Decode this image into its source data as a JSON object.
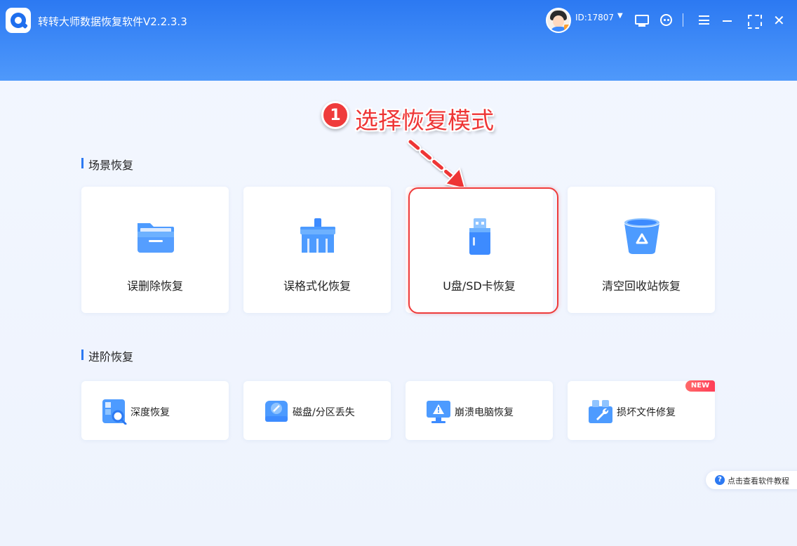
{
  "app": {
    "title": "转转大师数据恢复软件V2.2.3.3",
    "user_id": "ID:17807",
    "accent_color": "#2c79f2",
    "icons": [
      "app-logo-icon",
      "avatar",
      "chevron-down-icon",
      "monitor-icon",
      "support-icon",
      "menu-icon",
      "minimize-icon",
      "maximize-icon",
      "close-icon"
    ]
  },
  "annotation": {
    "step_number": "1",
    "text": "选择恢复模式",
    "color": "#ee3535"
  },
  "scene_recovery": {
    "title": "场景恢复",
    "items": [
      {
        "label": "误删除恢复",
        "icon": "folder-icon"
      },
      {
        "label": "误格式化恢复",
        "icon": "broom-icon"
      },
      {
        "label": "U盘/SD卡恢复",
        "icon": "usb-drive-icon",
        "highlighted": true
      },
      {
        "label": "清空回收站恢复",
        "icon": "recycle-bin-icon"
      }
    ]
  },
  "advanced_recovery": {
    "title": "进阶恢复",
    "items": [
      {
        "label": "深度恢复",
        "icon": "deep-scan-icon"
      },
      {
        "label": "磁盘/分区丢失",
        "icon": "disk-icon"
      },
      {
        "label": "崩溃电脑恢复",
        "icon": "crashed-computer-icon"
      },
      {
        "label": "损坏文件修复",
        "icon": "file-repair-icon",
        "badge": "NEW"
      }
    ]
  },
  "help": {
    "label": "点击查看软件教程",
    "icon_glyph": "?"
  }
}
